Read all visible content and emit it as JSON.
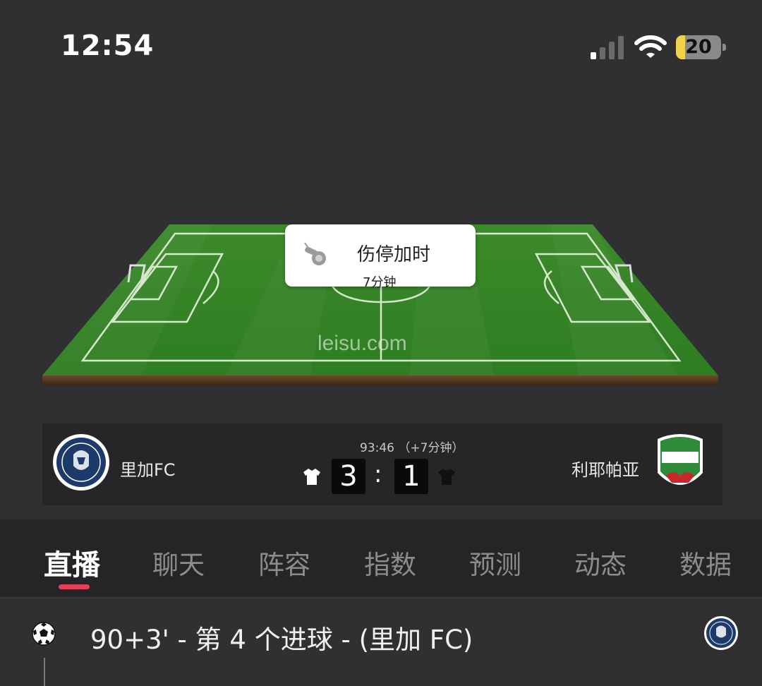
{
  "status_bar": {
    "time": "12:54",
    "battery_level": "20",
    "battery_fraction": 0.2,
    "battery_color": "#f1d34a",
    "signal_bars_active": 1,
    "icons": [
      "signal-icon",
      "wifi-icon",
      "battery-icon"
    ]
  },
  "pitch": {
    "watermark": "leisu.com",
    "popup": {
      "title": "伤停加时",
      "subtitle": "7分钟",
      "icon": "whistle-icon"
    }
  },
  "match": {
    "home_team": "里加FC",
    "away_team": "利耶帕亚",
    "clock": "93:46",
    "added_time": "（+7分钟）",
    "home_score": "3",
    "away_score": "1",
    "separator": ":",
    "home_crest_text": "RIGA FOOTBALL CLUB",
    "away_crest_text": "FK LIEPAJA",
    "home_jersey_color": "#ffffff",
    "away_jersey_color": "#111111"
  },
  "tabs": [
    {
      "label": "直播",
      "active": true
    },
    {
      "label": "聊天",
      "active": false
    },
    {
      "label": "阵容",
      "active": false
    },
    {
      "label": "指数",
      "active": false
    },
    {
      "label": "预测",
      "active": false
    },
    {
      "label": "动态",
      "active": false
    },
    {
      "label": "数据",
      "active": false
    }
  ],
  "tab_indicator_color": "#e0405a",
  "events": [
    {
      "text": "90+3' - 第 4 个进球 - (里加 FC)",
      "icon": "soccer-ball-icon",
      "team_crest": "riga-fc-crest-icon"
    }
  ]
}
